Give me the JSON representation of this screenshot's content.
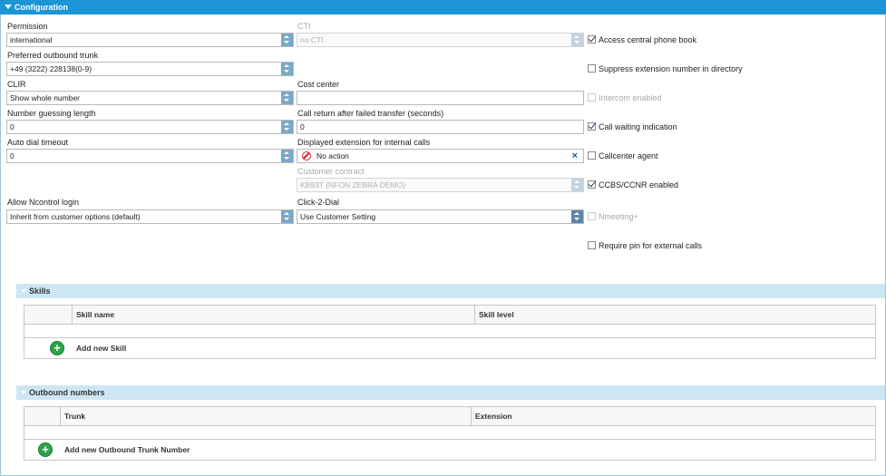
{
  "panel": {
    "title": "Configuration"
  },
  "col1": {
    "permission": {
      "label": "Permission",
      "value": "international"
    },
    "trunk": {
      "label": "Preferred outbound trunk",
      "value": "+49 (3222) 228138(0-9)"
    },
    "clir": {
      "label": "CLIR",
      "value": "Show whole number"
    },
    "guessing": {
      "label": "Number guessing length",
      "value": "0"
    },
    "autodial": {
      "label": "Auto dial timeout",
      "value": "0"
    },
    "ncontrol": {
      "label": "Allow Ncontrol login",
      "value": "Inherit from customer options (default)"
    }
  },
  "col2": {
    "cti": {
      "label": "CTI",
      "value": "no CTI"
    },
    "cost": {
      "label": "Cost center",
      "value": ""
    },
    "callreturn": {
      "label": "Call return after failed transfer (seconds)",
      "value": "0"
    },
    "displayed": {
      "label": "Displayed extension for internal calls",
      "value": "No action"
    },
    "contract": {
      "label": "Customer contract",
      "value": "KB93T (NFON ZEBRA DEMO)"
    },
    "c2d": {
      "label": "Click-2-Dial",
      "value": "Use Customer Setting"
    }
  },
  "checkboxes": {
    "phonebook": {
      "label": "Access central phone book",
      "checked": true
    },
    "suppress": {
      "label": "Suppress extension number in directory",
      "checked": false
    },
    "intercom": {
      "label": "Intercom enabled",
      "checked": false
    },
    "waiting": {
      "label": "Call waiting indication",
      "checked": true
    },
    "callcenter": {
      "label": "Callcenter agent",
      "checked": false
    },
    "ccbs": {
      "label": "CCBS/CCNR enabled",
      "checked": true
    },
    "nmeeting": {
      "label": "Nmeeting+",
      "checked": false
    },
    "pin": {
      "label": "Require pin for external calls",
      "checked": false
    }
  },
  "skills": {
    "title": "Skills",
    "columns": [
      "Skill name",
      "Skill level"
    ],
    "add_label": "Add new Skill"
  },
  "outbound": {
    "title": "Outbound numbers",
    "columns": [
      "Trunk",
      "Extension"
    ],
    "add_label": "Add new Outbound Trunk Number"
  },
  "icons": {
    "add": "plus-circle-icon",
    "no_action": "no-entry-icon",
    "clear": "close-icon",
    "spinner": "spinner-arrows-icon",
    "collapse": "triangle-down-icon"
  },
  "colors": {
    "header": "#1c95d4",
    "section": "#cde6f4",
    "add": "#2fa34a"
  }
}
